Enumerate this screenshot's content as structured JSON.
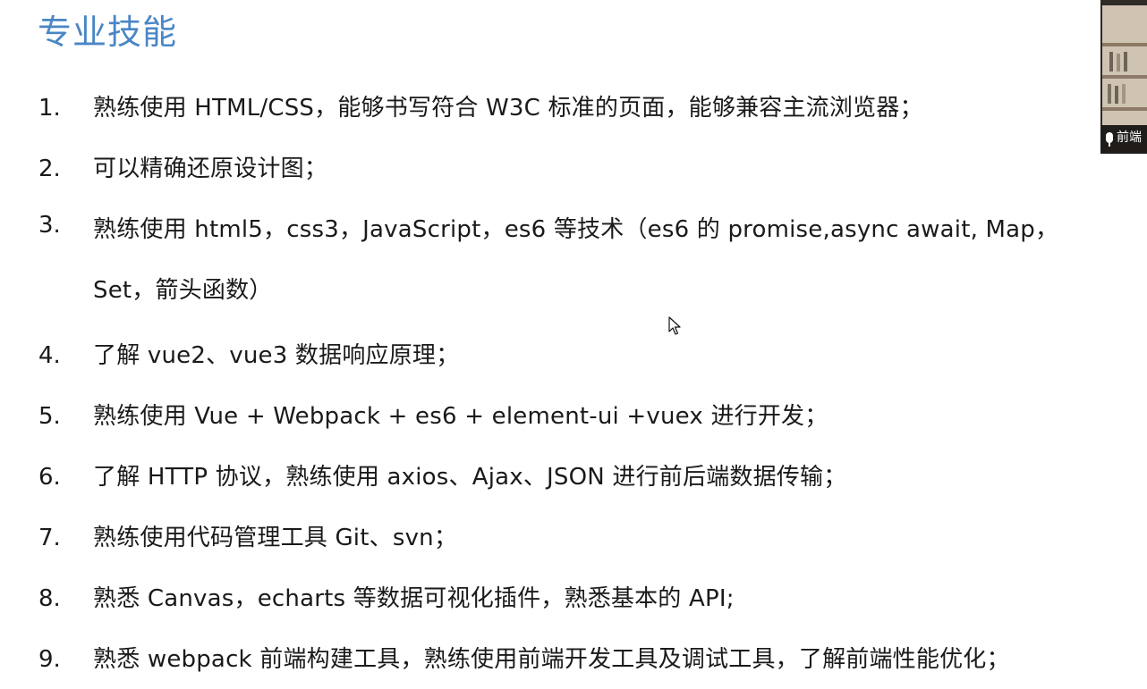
{
  "title": "专业技能",
  "skills": [
    {
      "num": "1.",
      "text": "熟练使用 HTML/CSS，能够书写符合 W3C 标准的页面，能够兼容主流浏览器；"
    },
    {
      "num": "2.",
      "text": "可以精确还原设计图；"
    },
    {
      "num": "3.",
      "text": "熟练使用 html5，css3，JavaScript，es6 等技术（es6 的 promise,async await, Map，Set，箭头函数）"
    },
    {
      "num": "4.",
      "text": "了解 vue2、vue3 数据响应原理；"
    },
    {
      "num": "5.",
      "text": "熟练使用 Vue + Webpack + es6 + element-ui +vuex 进行开发；"
    },
    {
      "num": "6.",
      "text": "了解 HTTP 协议，熟练使用 axios、Ajax、JSON 进行前后端数据传输；"
    },
    {
      "num": "7.",
      "text": "熟练使用代码管理工具 Git、svn；"
    },
    {
      "num": "8.",
      "text": "熟悉 Canvas，echarts 等数据可视化插件，熟悉基本的 API;"
    },
    {
      "num": "9.",
      "text": "熟悉 webpack 前端构建工具，熟练使用前端开发工具及调试工具，了解前端性能优化；"
    }
  ],
  "camera": {
    "name_label": "前端",
    "mic_icon": "microphone-icon"
  },
  "cursor_icon": "mouse-pointer-icon",
  "colors": {
    "title": "#4a86c5",
    "text": "#1a1a1a",
    "background": "#ffffff"
  }
}
